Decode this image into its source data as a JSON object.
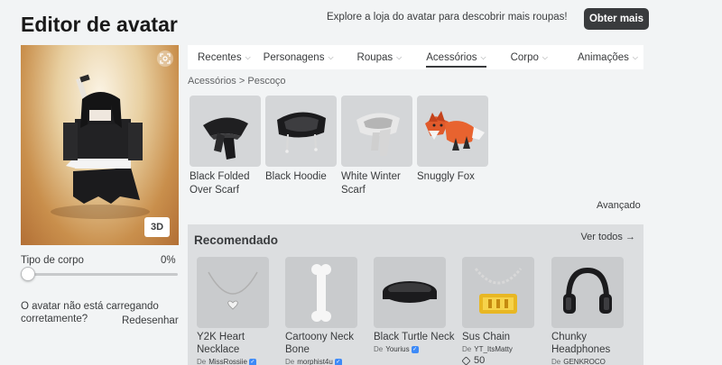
{
  "header": {
    "title": "Editor de avatar",
    "promo_text": "Explore a loja do avatar para descobrir mais roupas!",
    "get_more_label": "Obter mais"
  },
  "preview": {
    "view_mode_label": "3D",
    "screenshot_icon": "camera-frame-icon"
  },
  "body_type": {
    "label": "Tipo de corpo",
    "value_text": "0%",
    "value": 0
  },
  "loading_help": {
    "question": "O avatar não está carregando corretamente?",
    "redraw_label": "Redesenhar"
  },
  "tabs": [
    {
      "label": "Recentes",
      "active": false
    },
    {
      "label": "Personagens",
      "active": false
    },
    {
      "label": "Roupas",
      "active": false
    },
    {
      "label": "Acessórios",
      "active": true
    },
    {
      "label": "Corpo",
      "active": false
    },
    {
      "label": "Animações",
      "active": false
    }
  ],
  "breadcrumb": {
    "parent": "Acessórios",
    "separator": ">",
    "current": "Pescoço"
  },
  "items": [
    {
      "name": "Black Folded Over Scarf",
      "icon": "black-folded-scarf-icon"
    },
    {
      "name": "Black Hoodie",
      "icon": "black-hoodie-icon"
    },
    {
      "name": "White Winter Scarf",
      "icon": "white-winter-scarf-icon"
    },
    {
      "name": "Snuggly Fox",
      "icon": "snuggly-fox-icon"
    }
  ],
  "advanced_label": "Avançado",
  "recommended": {
    "title": "Recomendado",
    "see_all_label": "Ver todos →",
    "by_label": "De",
    "items": [
      {
        "name": "Y2K Heart Necklace",
        "creator": "MissRossiie",
        "verified": true,
        "price": ""
      },
      {
        "name": "Cartoony Neck Bone",
        "creator": "morphist4u",
        "verified": true,
        "price": ""
      },
      {
        "name": "Black Turtle Neck",
        "creator": "Yourius",
        "verified": true,
        "price": ""
      },
      {
        "name": "Sus Chain",
        "creator": "YT_ItsMatty",
        "verified": false,
        "price": "50"
      },
      {
        "name": "Chunky Headphones",
        "creator": "GENKROCO",
        "verified": false,
        "price": ""
      }
    ]
  },
  "colors": {
    "background": "#f2f4f5",
    "button_dark": "#393b3d",
    "verified_blue": "#3d8af7",
    "preview_bg": "#d9a867"
  }
}
